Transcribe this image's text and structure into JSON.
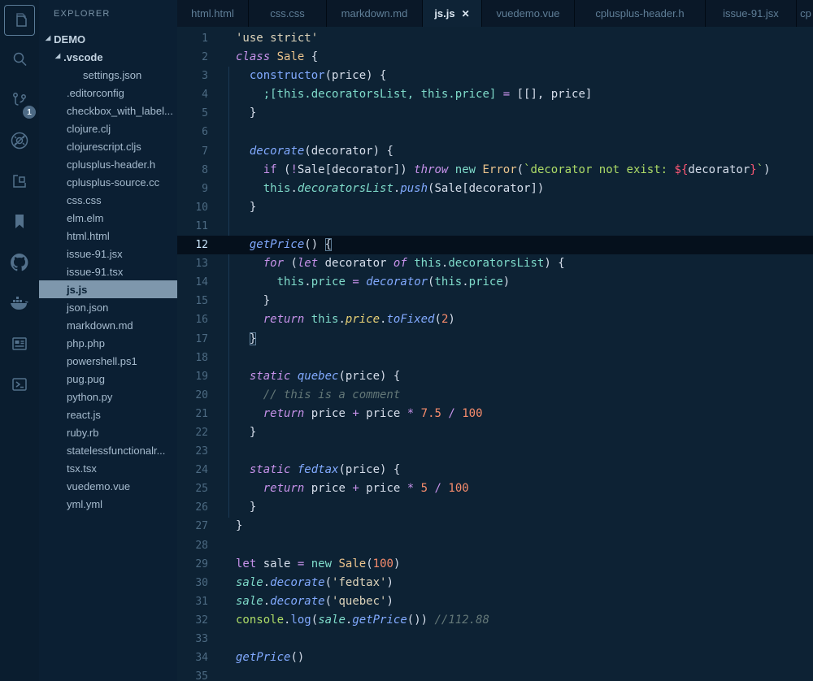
{
  "theme": {
    "editor_bg": "#0d2234",
    "sidebar_bg": "#0b1f33",
    "activity_bar_bg": "#0a1d2f",
    "tabbar_bg": "#030d18",
    "selection_bg": "#7e97ac",
    "keyword_color": "#c792ea",
    "function_color": "#82aaff",
    "teal_color": "#7fdbca",
    "class_color": "#ecc48d",
    "string_color": "#ddd3ba",
    "template_string_color": "#addb67",
    "number_color": "#f78c6c",
    "comment_color": "#637777",
    "default_text": "#d6deeb"
  },
  "activity_bar": {
    "items": [
      {
        "name": "explorer-icon",
        "active": true
      },
      {
        "name": "search-icon"
      },
      {
        "name": "source-control-icon",
        "badge": "1"
      },
      {
        "name": "debug-disabled-icon"
      },
      {
        "name": "extensions-icon"
      },
      {
        "name": "bookmark-icon"
      },
      {
        "name": "github-icon"
      },
      {
        "name": "docker-icon"
      },
      {
        "name": "browser-preview-icon"
      },
      {
        "name": "powershell-icon"
      }
    ]
  },
  "explorer": {
    "header": "EXPLORER",
    "items": [
      {
        "label": "DEMO",
        "level": 0,
        "kind": "folder",
        "expanded": true
      },
      {
        "label": ".vscode",
        "level": 1,
        "kind": "folder",
        "expanded": true
      },
      {
        "label": "settings.json",
        "level": 2,
        "kind": "file"
      },
      {
        "label": ".editorconfig",
        "level": 1,
        "kind": "file"
      },
      {
        "label": "checkbox_with_label...",
        "level": 1,
        "kind": "file"
      },
      {
        "label": "clojure.clj",
        "level": 1,
        "kind": "file"
      },
      {
        "label": "clojurescript.cljs",
        "level": 1,
        "kind": "file"
      },
      {
        "label": "cplusplus-header.h",
        "level": 1,
        "kind": "file"
      },
      {
        "label": "cplusplus-source.cc",
        "level": 1,
        "kind": "file"
      },
      {
        "label": "css.css",
        "level": 1,
        "kind": "file"
      },
      {
        "label": "elm.elm",
        "level": 1,
        "kind": "file"
      },
      {
        "label": "html.html",
        "level": 1,
        "kind": "file"
      },
      {
        "label": "issue-91.jsx",
        "level": 1,
        "kind": "file"
      },
      {
        "label": "issue-91.tsx",
        "level": 1,
        "kind": "file"
      },
      {
        "label": "js.js",
        "level": 1,
        "kind": "file",
        "selected": true
      },
      {
        "label": "json.json",
        "level": 1,
        "kind": "file"
      },
      {
        "label": "markdown.md",
        "level": 1,
        "kind": "file"
      },
      {
        "label": "php.php",
        "level": 1,
        "kind": "file"
      },
      {
        "label": "powershell.ps1",
        "level": 1,
        "kind": "file"
      },
      {
        "label": "pug.pug",
        "level": 1,
        "kind": "file"
      },
      {
        "label": "python.py",
        "level": 1,
        "kind": "file"
      },
      {
        "label": "react.js",
        "level": 1,
        "kind": "file"
      },
      {
        "label": "ruby.rb",
        "level": 1,
        "kind": "file"
      },
      {
        "label": "statelessfunctionalr...",
        "level": 1,
        "kind": "file"
      },
      {
        "label": "tsx.tsx",
        "level": 1,
        "kind": "file"
      },
      {
        "label": "vuedemo.vue",
        "level": 1,
        "kind": "file"
      },
      {
        "label": "yml.yml",
        "level": 1,
        "kind": "file"
      }
    ]
  },
  "tabs": [
    {
      "label": "html.html"
    },
    {
      "label": "css.css"
    },
    {
      "label": "markdown.md"
    },
    {
      "label": "js.js",
      "active": true,
      "close": "✕"
    },
    {
      "label": "vuedemo.vue"
    },
    {
      "label": "cplusplus-header.h"
    },
    {
      "label": "issue-91.jsx"
    },
    {
      "label": "cp",
      "clipped": true
    }
  ],
  "editor": {
    "current_line": 12,
    "lines": [
      {
        "n": 1,
        "tokens": [
          [
            "str",
            "'use strict'"
          ]
        ]
      },
      {
        "n": 2,
        "tokens": [
          [
            "ki",
            "class"
          ],
          [
            "d",
            " "
          ],
          [
            "cls",
            "Sale"
          ],
          [
            "d",
            " {"
          ]
        ]
      },
      {
        "n": 3,
        "tokens": [
          [
            "d",
            "  "
          ],
          [
            "fnu",
            "constructor"
          ],
          [
            "d",
            "(price) {"
          ]
        ]
      },
      {
        "n": 4,
        "tokens": [
          [
            "d",
            "    "
          ],
          [
            "t",
            ";[this.decoratorsList, this.price]"
          ],
          [
            "op",
            " = "
          ],
          [
            "d",
            "[[], price]"
          ]
        ]
      },
      {
        "n": 5,
        "tokens": [
          [
            "d",
            "  }"
          ]
        ]
      },
      {
        "n": 6,
        "tokens": []
      },
      {
        "n": 7,
        "tokens": [
          [
            "d",
            "  "
          ],
          [
            "fn",
            "decorate"
          ],
          [
            "d",
            "(decorator) {"
          ]
        ]
      },
      {
        "n": 8,
        "tokens": [
          [
            "d",
            "    "
          ],
          [
            "k",
            "if"
          ],
          [
            "d",
            " ("
          ],
          [
            "op",
            "!"
          ],
          [
            "d",
            "Sale[decorator]) "
          ],
          [
            "ki",
            "throw"
          ],
          [
            "d",
            " "
          ],
          [
            "t",
            "new"
          ],
          [
            "d",
            " "
          ],
          [
            "cls",
            "Error"
          ],
          [
            "d",
            "("
          ],
          [
            "tstr",
            "`decorator not exist: "
          ],
          [
            "interp",
            "${"
          ],
          [
            "d",
            "decorator"
          ],
          [
            "interp",
            "}"
          ],
          [
            "tstr",
            "`"
          ],
          [
            "d",
            ")"
          ]
        ]
      },
      {
        "n": 9,
        "tokens": [
          [
            "d",
            "    "
          ],
          [
            "t",
            "this"
          ],
          [
            "d",
            "."
          ],
          [
            "ti",
            "decoratorsList"
          ],
          [
            "d",
            "."
          ],
          [
            "fn",
            "push"
          ],
          [
            "d",
            "(Sale[decorator])"
          ]
        ]
      },
      {
        "n": 10,
        "tokens": [
          [
            "d",
            "  }"
          ]
        ]
      },
      {
        "n": 11,
        "tokens": []
      },
      {
        "n": 12,
        "tokens": [
          [
            "d",
            "  "
          ],
          [
            "fn",
            "getPrice"
          ],
          [
            "d",
            "() "
          ],
          [
            "bm",
            "{"
          ]
        ]
      },
      {
        "n": 13,
        "tokens": [
          [
            "d",
            "    "
          ],
          [
            "ki",
            "for"
          ],
          [
            "d",
            " ("
          ],
          [
            "ki",
            "let"
          ],
          [
            "d",
            " decorator "
          ],
          [
            "ki",
            "of"
          ],
          [
            "d",
            " "
          ],
          [
            "t",
            "this"
          ],
          [
            "d",
            "."
          ],
          [
            "t",
            "decoratorsList"
          ],
          [
            "d",
            ") {"
          ]
        ]
      },
      {
        "n": 14,
        "tokens": [
          [
            "d",
            "      "
          ],
          [
            "t",
            "this"
          ],
          [
            "d",
            "."
          ],
          [
            "t",
            "price"
          ],
          [
            "op",
            " = "
          ],
          [
            "fn",
            "decorator"
          ],
          [
            "d",
            "("
          ],
          [
            "t",
            "this"
          ],
          [
            "d",
            "."
          ],
          [
            "t",
            "price"
          ],
          [
            "d",
            ")"
          ]
        ]
      },
      {
        "n": 15,
        "tokens": [
          [
            "d",
            "    }"
          ]
        ]
      },
      {
        "n": 16,
        "tokens": [
          [
            "d",
            "    "
          ],
          [
            "ki",
            "return"
          ],
          [
            "d",
            " "
          ],
          [
            "t",
            "this"
          ],
          [
            "d",
            "."
          ],
          [
            "y",
            "price"
          ],
          [
            "d",
            "."
          ],
          [
            "fn",
            "toFixed"
          ],
          [
            "d",
            "("
          ],
          [
            "num",
            "2"
          ],
          [
            "d",
            ")"
          ]
        ]
      },
      {
        "n": 17,
        "tokens": [
          [
            "d",
            "  "
          ],
          [
            "bm",
            "}"
          ]
        ]
      },
      {
        "n": 18,
        "tokens": []
      },
      {
        "n": 19,
        "tokens": [
          [
            "d",
            "  "
          ],
          [
            "ki",
            "static"
          ],
          [
            "d",
            " "
          ],
          [
            "fn",
            "quebec"
          ],
          [
            "d",
            "(price) {"
          ]
        ]
      },
      {
        "n": 20,
        "tokens": [
          [
            "d",
            "    "
          ],
          [
            "cm",
            "// this is a comment"
          ]
        ]
      },
      {
        "n": 21,
        "tokens": [
          [
            "d",
            "    "
          ],
          [
            "ki",
            "return"
          ],
          [
            "d",
            " price "
          ],
          [
            "op",
            "+"
          ],
          [
            "d",
            " price "
          ],
          [
            "op",
            "*"
          ],
          [
            "d",
            " "
          ],
          [
            "num",
            "7.5"
          ],
          [
            "d",
            " "
          ],
          [
            "op",
            "/"
          ],
          [
            "d",
            " "
          ],
          [
            "num",
            "100"
          ]
        ]
      },
      {
        "n": 22,
        "tokens": [
          [
            "d",
            "  }"
          ]
        ]
      },
      {
        "n": 23,
        "tokens": []
      },
      {
        "n": 24,
        "tokens": [
          [
            "d",
            "  "
          ],
          [
            "ki",
            "static"
          ],
          [
            "d",
            " "
          ],
          [
            "fn",
            "fedtax"
          ],
          [
            "d",
            "(price) {"
          ]
        ]
      },
      {
        "n": 25,
        "tokens": [
          [
            "d",
            "    "
          ],
          [
            "ki",
            "return"
          ],
          [
            "d",
            " price "
          ],
          [
            "op",
            "+"
          ],
          [
            "d",
            " price "
          ],
          [
            "op",
            "*"
          ],
          [
            "d",
            " "
          ],
          [
            "num",
            "5"
          ],
          [
            "d",
            " "
          ],
          [
            "op",
            "/"
          ],
          [
            "d",
            " "
          ],
          [
            "num",
            "100"
          ]
        ]
      },
      {
        "n": 26,
        "tokens": [
          [
            "d",
            "  }"
          ]
        ]
      },
      {
        "n": 27,
        "tokens": [
          [
            "d",
            "}"
          ]
        ]
      },
      {
        "n": 28,
        "tokens": []
      },
      {
        "n": 29,
        "tokens": [
          [
            "k",
            "let"
          ],
          [
            "d",
            " sale "
          ],
          [
            "op",
            "="
          ],
          [
            "d",
            " "
          ],
          [
            "t",
            "new"
          ],
          [
            "d",
            " "
          ],
          [
            "cls",
            "Sale"
          ],
          [
            "d",
            "("
          ],
          [
            "num",
            "100"
          ],
          [
            "d",
            ")"
          ]
        ]
      },
      {
        "n": 30,
        "tokens": [
          [
            "ti",
            "sale"
          ],
          [
            "d",
            "."
          ],
          [
            "fn",
            "decorate"
          ],
          [
            "d",
            "("
          ],
          [
            "str",
            "'fedtax'"
          ],
          [
            "d",
            ")"
          ]
        ]
      },
      {
        "n": 31,
        "tokens": [
          [
            "ti",
            "sale"
          ],
          [
            "d",
            "."
          ],
          [
            "fn",
            "decorate"
          ],
          [
            "d",
            "("
          ],
          [
            "str",
            "'quebec'"
          ],
          [
            "d",
            ")"
          ]
        ]
      },
      {
        "n": 32,
        "tokens": [
          [
            "gr",
            "console"
          ],
          [
            "d",
            "."
          ],
          [
            "fnu",
            "log"
          ],
          [
            "d",
            "("
          ],
          [
            "ti",
            "sale"
          ],
          [
            "d",
            "."
          ],
          [
            "fn",
            "getPrice"
          ],
          [
            "d",
            "()) "
          ],
          [
            "cm",
            "//112.88"
          ]
        ]
      },
      {
        "n": 33,
        "tokens": []
      },
      {
        "n": 34,
        "tokens": [
          [
            "fn",
            "getPrice"
          ],
          [
            "d",
            "()"
          ]
        ]
      },
      {
        "n": 35,
        "tokens": []
      }
    ]
  }
}
